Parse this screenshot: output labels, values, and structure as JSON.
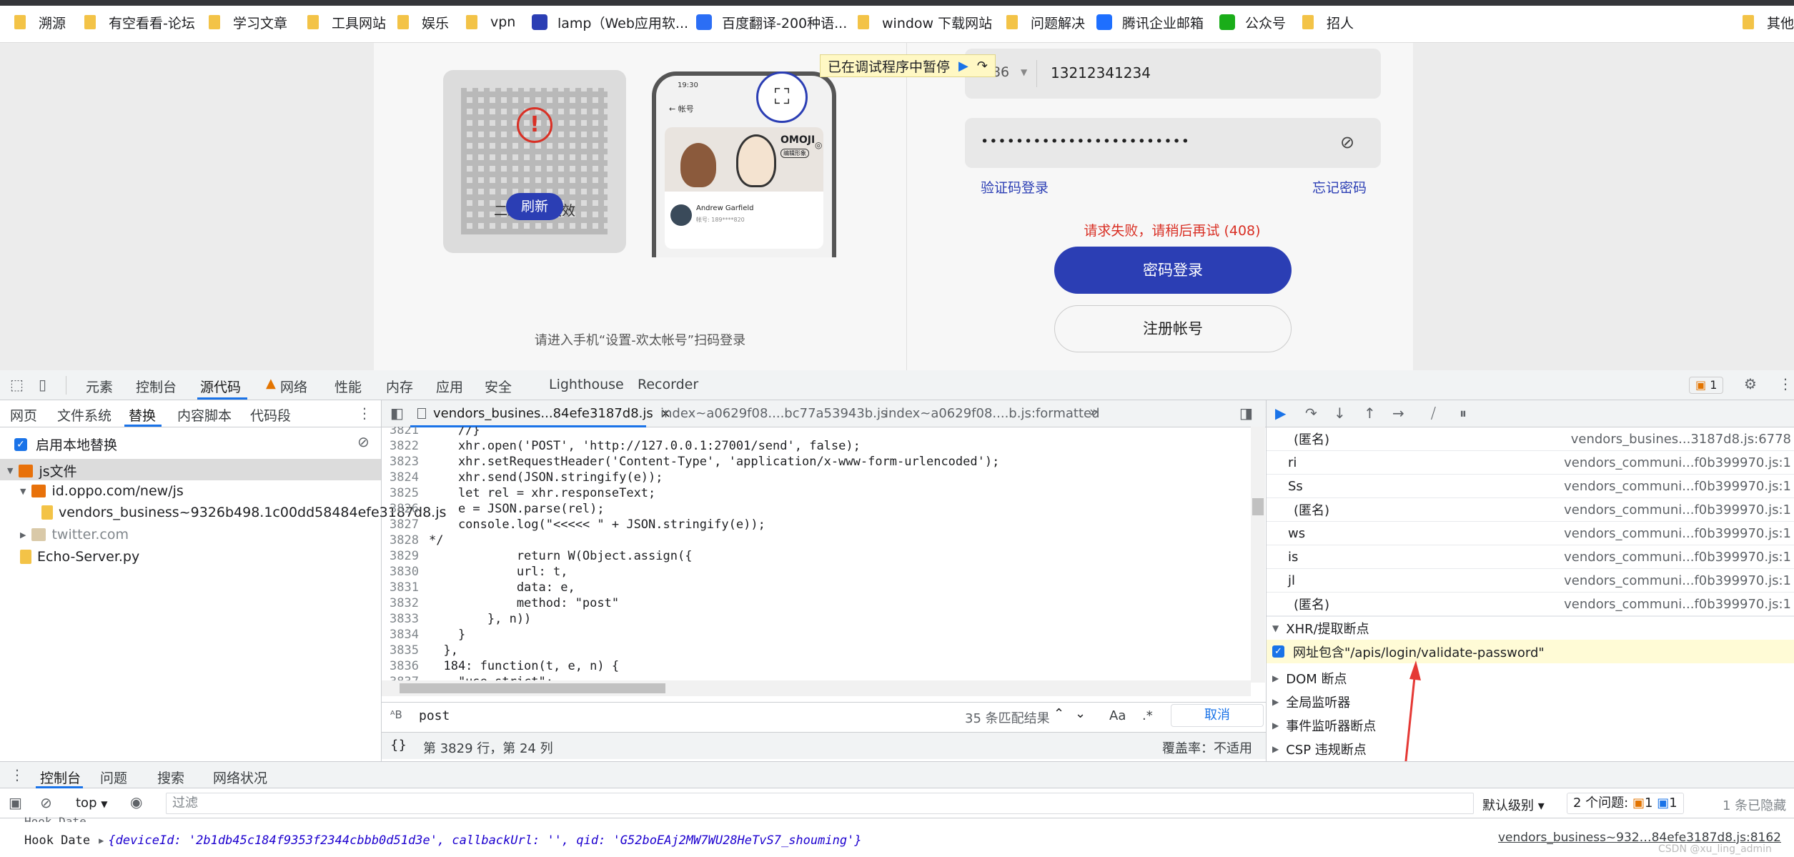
{
  "bookmarks": [
    {
      "label": "溯源",
      "icon": "folder-icon"
    },
    {
      "label": "有空看看-论坛",
      "icon": "folder-icon"
    },
    {
      "label": "学习文章",
      "icon": "folder-icon"
    },
    {
      "label": "工具网站",
      "icon": "folder-icon"
    },
    {
      "label": "娱乐",
      "icon": "folder-icon"
    },
    {
      "label": "vpn",
      "icon": "folder-icon"
    },
    {
      "label": "lamp（Web应用软...",
      "icon": "paw-icon"
    },
    {
      "label": "百度翻译-200种语...",
      "icon": "translate-icon"
    },
    {
      "label": "window 下载网站",
      "icon": "folder-icon"
    },
    {
      "label": "问题解决",
      "icon": "folder-icon"
    },
    {
      "label": "腾讯企业邮箱",
      "icon": "tencent-icon"
    },
    {
      "label": "公众号",
      "icon": "wechat-icon"
    },
    {
      "label": "招人",
      "icon": "folder-icon"
    },
    {
      "label": "其他",
      "icon": "folder-icon"
    }
  ],
  "page": {
    "paused_label": "已在调试程序中暂停",
    "phone_prefix": "+86",
    "phone_value": "13212341234",
    "password_mask": "••••••••••••••••••••••••",
    "sms_login": "验证码登录",
    "forgot_password": "忘记密码",
    "error": "请求失败，请稍后再试 (408)",
    "password_login": "密码登录",
    "register": "注册帐号",
    "qr_expired": "二维码已失效",
    "qr_refresh": "刷新",
    "qr_hint": "请进入手机“设置-欢太帐号”扫码登录",
    "phone_mock": {
      "time": "19:30",
      "title": "帐号",
      "brand": "OMOJI",
      "brand_btn": "编辑形象",
      "user": "Andrew Garfield",
      "account": "帐号: 189****820"
    }
  },
  "devtools": {
    "main_tabs": [
      "元素",
      "控制台",
      "源代码",
      "网络",
      "性能",
      "内存",
      "应用",
      "安全",
      "Lighthouse",
      "Recorder"
    ],
    "active_main_tab": "源代码",
    "issues_badge": "1",
    "left_tabs": [
      "网页",
      "文件系统",
      "替换",
      "内容脚本",
      "代码段"
    ],
    "active_left_tab": "替换",
    "enable_override": "启用本地替换",
    "tree": [
      {
        "label": "js文件",
        "level": 0
      },
      {
        "label": "id.oppo.com/new/js",
        "level": 1
      },
      {
        "label": "vendors_business~9326b498.1c00dd58484efe3187d8.js",
        "level": 2
      },
      {
        "label": "twitter.com",
        "level": 1
      },
      {
        "label": "Echo-Server.py",
        "level": 1
      }
    ],
    "file_tabs": [
      "vendors_busines...84efe3187d8.js",
      "index~a0629f08....bc77a53943b.js",
      "index~a0629f08....b.js:formatted"
    ],
    "code_lines": [
      {
        "n": "3821",
        "t": "    //}"
      },
      {
        "n": "3822",
        "t": "    xhr.open('POST', 'http://127.0.0.1:27001/send', false);"
      },
      {
        "n": "3823",
        "t": "    xhr.setRequestHeader('Content-Type', 'application/x-www-form-urlencoded');"
      },
      {
        "n": "3824",
        "t": "    xhr.send(JSON.stringify(e));"
      },
      {
        "n": "3825",
        "t": "    let rel = xhr.responseText;"
      },
      {
        "n": "3826",
        "t": "    e = JSON.parse(rel);"
      },
      {
        "n": "3827",
        "t": "    console.log(\"<<<<< \" + JSON.stringify(e));"
      },
      {
        "n": "3828",
        "t": "*/"
      },
      {
        "n": "3829",
        "t": "            return W(Object.assign({"
      },
      {
        "n": "3830",
        "t": "            url: t,"
      },
      {
        "n": "3831",
        "t": "            data: e,"
      },
      {
        "n": "3832",
        "t": "            method: \"post\""
      },
      {
        "n": "3833",
        "t": "        }, n))"
      },
      {
        "n": "3834",
        "t": "    }"
      },
      {
        "n": "3835",
        "t": "  },"
      },
      {
        "n": "3836",
        "t": "  184: function(t, e, n) {"
      },
      {
        "n": "3837",
        "t": "    \"use strict\";"
      }
    ],
    "search": {
      "value": "post",
      "count": "35 条匹配结果",
      "match_case": "Aa",
      "regex": ".*",
      "cancel": "取消"
    },
    "status": {
      "position": "第 3829 行，第 24 列",
      "coverage": "覆盖率：不适用"
    },
    "call_stack": [
      {
        "name": "(匿名)",
        "file": "vendors_busines...3187d8.js:6778"
      },
      {
        "name": "ri",
        "file": "vendors_communi...f0b399970.js:1"
      },
      {
        "name": "Ss",
        "file": "vendors_communi...f0b399970.js:1"
      },
      {
        "name": "(匿名)",
        "file": "vendors_communi...f0b399970.js:1"
      },
      {
        "name": "ws",
        "file": "vendors_communi...f0b399970.js:1"
      },
      {
        "name": "is",
        "file": "vendors_communi...f0b399970.js:1"
      },
      {
        "name": "jl",
        "file": "vendors_communi...f0b399970.js:1"
      },
      {
        "name": "(匿名)",
        "file": "vendors_communi...f0b399970.js:1"
      }
    ],
    "xhr_section": "XHR/提取断点",
    "xhr_breakpoint": "网址包含\"/apis/login/validate-password\"",
    "sections": [
      "DOM 断点",
      "全局监听器",
      "事件监听器断点",
      "CSP 违规断点"
    ],
    "drawer_tabs": [
      "控制台",
      "问题",
      "搜索",
      "网络状况"
    ],
    "active_drawer_tab": "控制台",
    "console": {
      "context": "top",
      "filter_placeholder": "过滤",
      "level": "默认级别",
      "issues": "2 个问题:",
      "issues_warn": "1",
      "issues_info": "1",
      "hidden": "1 条已隐藏",
      "partial_line": "Hook Date",
      "log_label": "Hook Date",
      "log_text": "{deviceId: '2b1db45c184f9353f2344cbbb0d51d3e', callbackUrl: '', qid: 'G52boEAj2MW7WU28HeTvS7_shouming'}",
      "log_source": "vendors_business~932…84efe3187d8.js:8162",
      "watermark": "CSDN @xu_ling_admin"
    }
  }
}
